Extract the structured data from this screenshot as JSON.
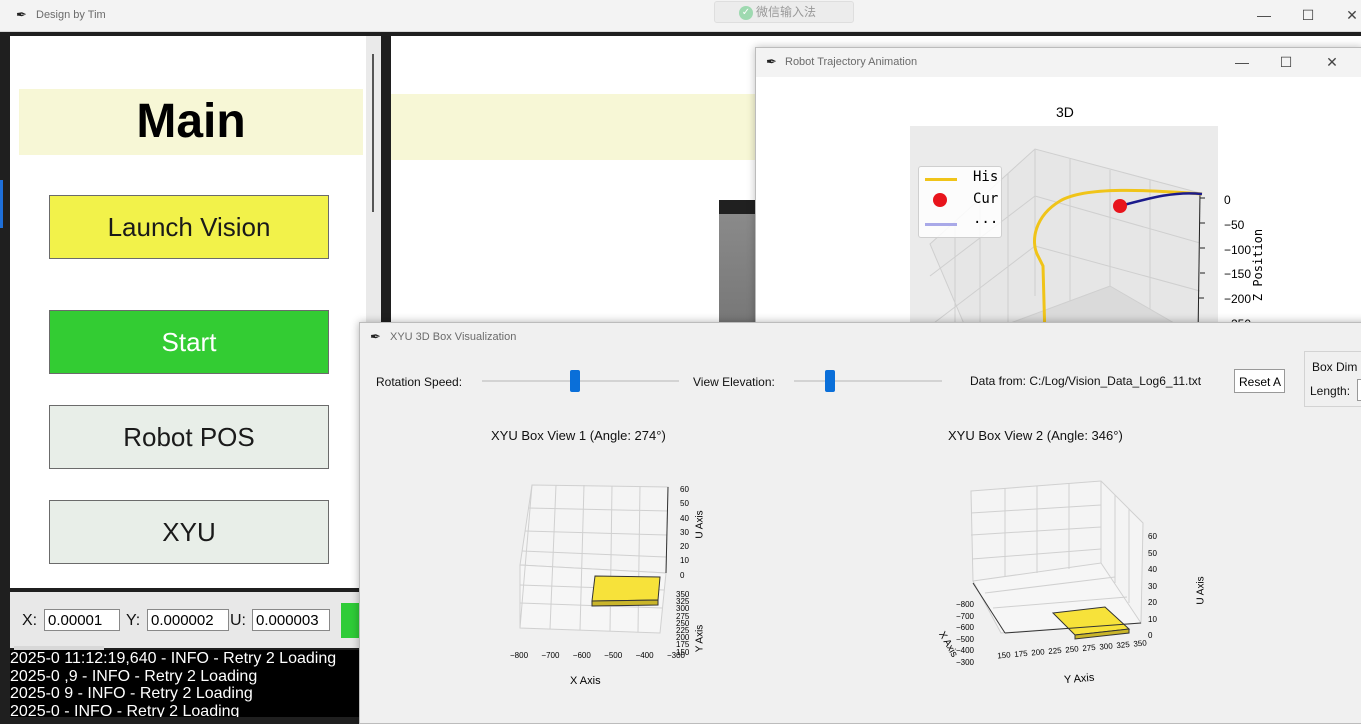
{
  "main_window": {
    "title": "Design by Tim",
    "ime_label": "微信输入法",
    "minimize": "—",
    "maximize": "☐",
    "close": "✕"
  },
  "left_panel": {
    "heading": "Main",
    "buttons": [
      {
        "label": "Launch Vision",
        "color": "#f2f24a"
      },
      {
        "label": "Start",
        "color": "#33cc33"
      },
      {
        "label": "Robot POS",
        "color": "#e8eee8"
      },
      {
        "label": "XYU",
        "color": "#e8eee8"
      }
    ]
  },
  "coords": {
    "x_label": "X:",
    "x_value": "0.00001",
    "y_label": "Y:",
    "y_value": "0.000002",
    "u_label": "U:",
    "u_value": "0.000003"
  },
  "log_lines": [
    "2025-0    11:12:19,640 - INFO - Retry 2 Loading",
    "2025-0         ,9 - INFO - Retry 2 Loading",
    "2025-0          9 - INFO - Retry 2 Loading",
    "2025-0           - INFO - Retry 2 Loading"
  ],
  "trajectory_window": {
    "title": "Robot Trajectory Animation",
    "plot_title": "3D",
    "legend": [
      "His",
      "Cur",
      "..."
    ],
    "zlabel": "Z Position",
    "zticks": [
      "0",
      "−50",
      "−100",
      "−150",
      "−200",
      "−250"
    ],
    "colors": {
      "history": "#f0c419",
      "current": "#e8141c",
      "dashed": "#a9a9e8",
      "recent": "#1a1a8c"
    }
  },
  "xyu_window": {
    "title": "XYU 3D Box Visualization",
    "rotation_label": "Rotation Speed:",
    "rotation_level": 0.47,
    "elevation_label": "View Elevation:",
    "elevation_level": 0.24,
    "data_from": "Data from: C:/Log/Vision_Data_Log6_11.txt",
    "reset_label": "Reset A",
    "box_dim_label": "Box Dim",
    "length_label": "Length:",
    "view1": {
      "title": "XYU Box View 1 (Angle: 274°)",
      "xlabel": "X Axis",
      "ylabel": "Y Axis",
      "ulabel": "U Axis",
      "x_ticks": [
        "−800",
        "−700",
        "−600",
        "−500",
        "−400",
        "−300"
      ],
      "u_ticks": [
        "60",
        "50",
        "40",
        "30",
        "20",
        "10",
        "0"
      ],
      "y_ticks": [
        "350",
        "325",
        "300",
        "275",
        "250",
        "225",
        "200",
        "175",
        "150"
      ]
    },
    "view2": {
      "title": "XYU Box View 2 (Angle: 346°)",
      "xlabel": "X Axis",
      "ylabel": "Y Axis",
      "ulabel": "U Axis",
      "x_ticks": [
        "−800",
        "−700",
        "−600",
        "−500",
        "−400",
        "−300"
      ],
      "y_ticks": [
        "150",
        "175",
        "200",
        "225",
        "250",
        "275",
        "300",
        "325",
        "350"
      ],
      "u_ticks": [
        "60",
        "50",
        "40",
        "30",
        "20",
        "10",
        "0"
      ]
    },
    "box_color": "#f7e23a"
  }
}
